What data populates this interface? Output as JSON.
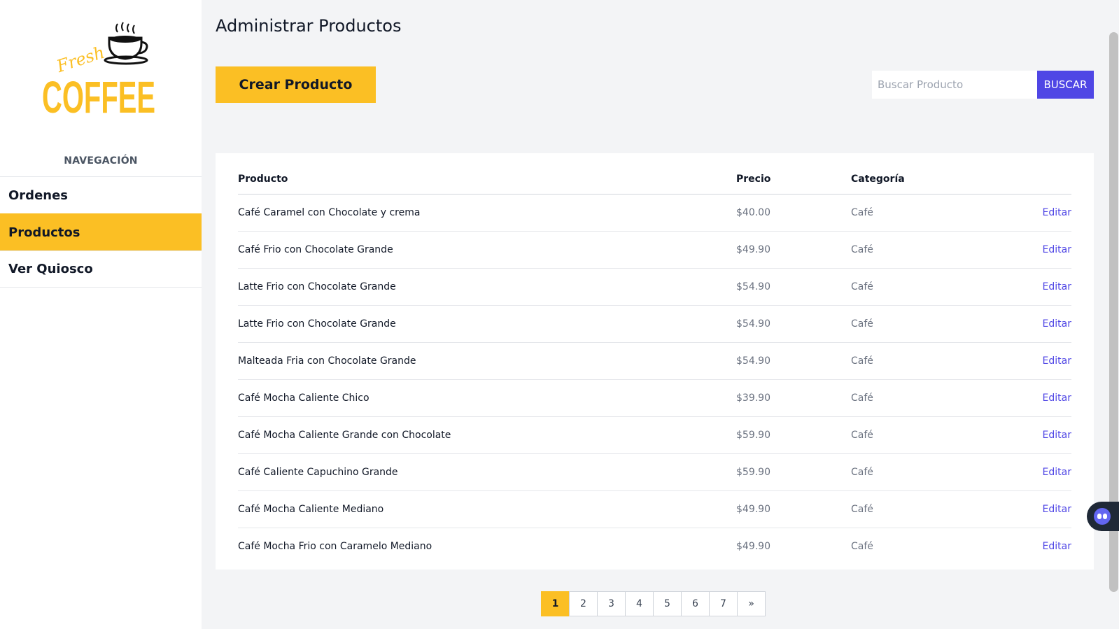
{
  "sidebar": {
    "logo_text_top": "Fresh",
    "logo_text_main": "COFFEE",
    "nav_heading": "NAVEGACIÓN",
    "items": [
      {
        "label": "Ordenes",
        "active": false
      },
      {
        "label": "Productos",
        "active": true
      },
      {
        "label": "Ver Quiosco",
        "active": false
      }
    ]
  },
  "main": {
    "title": "Administrar Productos",
    "create_button": "Crear Producto",
    "search": {
      "placeholder": "Buscar Producto",
      "value": "",
      "button": "BUSCAR"
    },
    "table": {
      "headers": [
        "Producto",
        "Precio",
        "Categoría",
        ""
      ],
      "rows": [
        {
          "name": "Café Caramel con Chocolate y crema",
          "price": "$40.00",
          "category": "Café",
          "action": "Editar"
        },
        {
          "name": "Café Frio con Chocolate Grande",
          "price": "$49.90",
          "category": "Café",
          "action": "Editar"
        },
        {
          "name": "Latte Frio con Chocolate Grande",
          "price": "$54.90",
          "category": "Café",
          "action": "Editar"
        },
        {
          "name": "Latte Frio con Chocolate Grande",
          "price": "$54.90",
          "category": "Café",
          "action": "Editar"
        },
        {
          "name": "Malteada Fria con Chocolate Grande",
          "price": "$54.90",
          "category": "Café",
          "action": "Editar"
        },
        {
          "name": "Café Mocha Caliente Chico",
          "price": "$39.90",
          "category": "Café",
          "action": "Editar"
        },
        {
          "name": "Café Mocha Caliente Grande con Chocolate",
          "price": "$59.90",
          "category": "Café",
          "action": "Editar"
        },
        {
          "name": "Café Caliente Capuchino Grande",
          "price": "$59.90",
          "category": "Café",
          "action": "Editar"
        },
        {
          "name": "Café Mocha Caliente Mediano",
          "price": "$49.90",
          "category": "Café",
          "action": "Editar"
        },
        {
          "name": "Café Mocha Frio con Caramelo Mediano",
          "price": "$49.90",
          "category": "Café",
          "action": "Editar"
        }
      ]
    },
    "pagination": {
      "pages": [
        "1",
        "2",
        "3",
        "4",
        "5",
        "6",
        "7",
        "»"
      ],
      "current": "1"
    }
  },
  "colors": {
    "accent": "#fbbf24",
    "primary": "#4f46e5",
    "background": "#f3f4f6"
  },
  "icons": {
    "logo": "coffee-cup-icon",
    "floating_widget": "assistant-bot-icon"
  }
}
